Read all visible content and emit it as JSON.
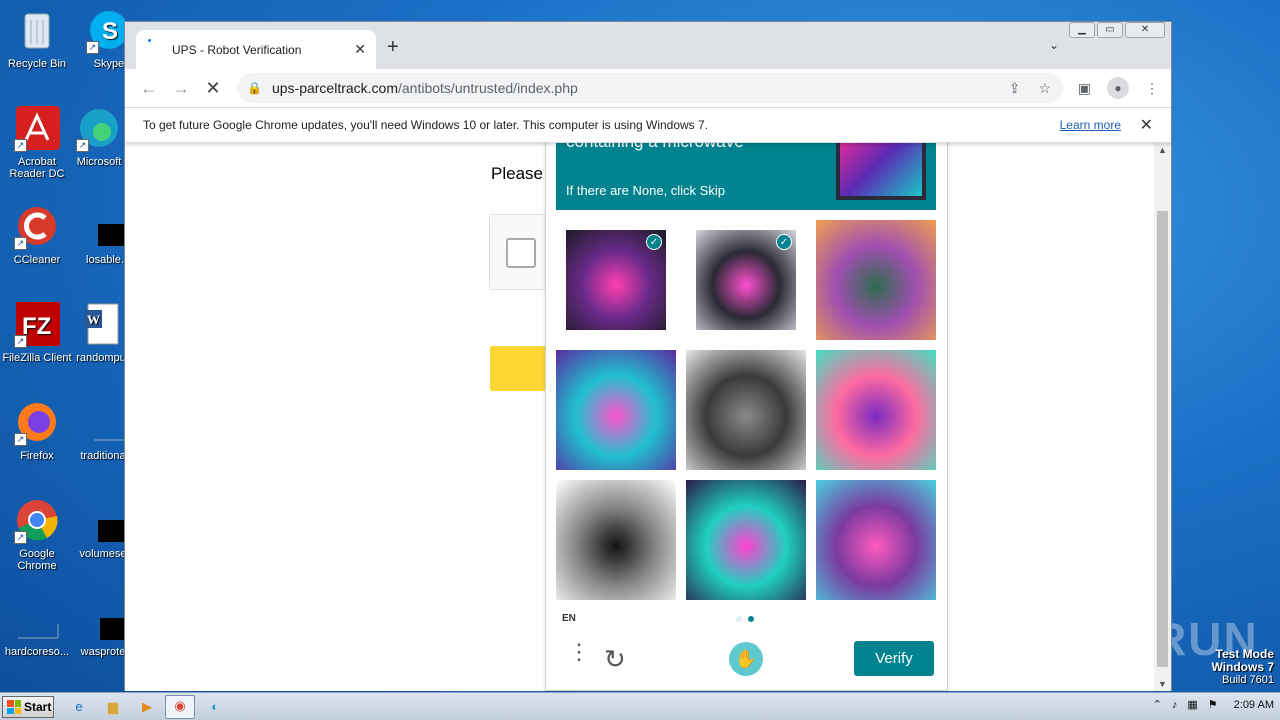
{
  "desktop": {
    "icons": [
      {
        "label": "Recycle Bin"
      },
      {
        "label": "Skype"
      },
      {
        "label": "Acrobat Reader DC"
      },
      {
        "label": "Microsoft"
      },
      {
        "label": "CCleaner"
      },
      {
        "label": "losable."
      },
      {
        "label": "FileZilla Client"
      },
      {
        "label": "randompu"
      },
      {
        "label": "Firefox"
      },
      {
        "label": "traditiona"
      },
      {
        "label": "Google Chrome"
      },
      {
        "label": "volumese"
      },
      {
        "label": "hardcoreso..."
      },
      {
        "label": "wasprote"
      }
    ],
    "watermark": "ANY RUN",
    "test_mode": {
      "line1": "Test Mode",
      "line2": "Windows 7",
      "line3": "Build 7601"
    }
  },
  "browser": {
    "tab": {
      "title": "UPS - Robot Verification",
      "close": "✕"
    },
    "new_tab": "+",
    "tab_dropdown": "⌄",
    "url": {
      "host": "ups-parceltrack.com",
      "path": "/antibots/untrusted/index.php"
    },
    "infobar": {
      "message": "To get future Google Chrome updates, you'll need Windows 10 or later. This computer is using Windows 7.",
      "link": "Learn more",
      "close": "✕"
    }
  },
  "page": {
    "heading": "Please"
  },
  "challenge": {
    "prompt_title": "containing a microwave",
    "prompt_sub": "If there are None, click Skip",
    "tiles": [
      {
        "name": "microwave-neon-1",
        "selected": true,
        "colors": [
          "#1b1b22",
          "#ff3fb0",
          "#6a2a8a"
        ]
      },
      {
        "name": "microwave-neon-2",
        "selected": true,
        "colors": [
          "#d7d7e0",
          "#ff4fcf",
          "#2a2a36"
        ]
      },
      {
        "name": "goat-statue",
        "selected": false,
        "colors": [
          "#f0a050",
          "#2f6b4f",
          "#a04fb0"
        ]
      },
      {
        "name": "neon-desk-1",
        "selected": false,
        "colors": [
          "#5a2aa0",
          "#ff55cc",
          "#20c0d0"
        ]
      },
      {
        "name": "violin-sketch",
        "selected": false,
        "colors": [
          "#e8e8e8",
          "#8a8a8a",
          "#3a3a3a"
        ]
      },
      {
        "name": "neon-desk-2",
        "selected": false,
        "colors": [
          "#40e0c0",
          "#7a2ac0",
          "#ff6aa0"
        ]
      },
      {
        "name": "panda-face",
        "selected": false,
        "colors": [
          "#ffffff",
          "#111111",
          "#888888"
        ]
      },
      {
        "name": "neon-desk-3",
        "selected": false,
        "colors": [
          "#2a1a4a",
          "#ff40d0",
          "#1fd0c0"
        ]
      },
      {
        "name": "neon-bedroom",
        "selected": false,
        "colors": [
          "#4ad0e0",
          "#ff5ac0",
          "#7a3aa0"
        ]
      }
    ],
    "language": "EN",
    "page_indicator": {
      "current": 2,
      "total": 2
    },
    "menu_icon": "⋮",
    "refresh_icon": "↻",
    "logo_icon": "✋",
    "verify_label": "Verify",
    "accent": "#00838f"
  },
  "taskbar": {
    "start_label": "Start",
    "clock": "2:09 AM"
  }
}
